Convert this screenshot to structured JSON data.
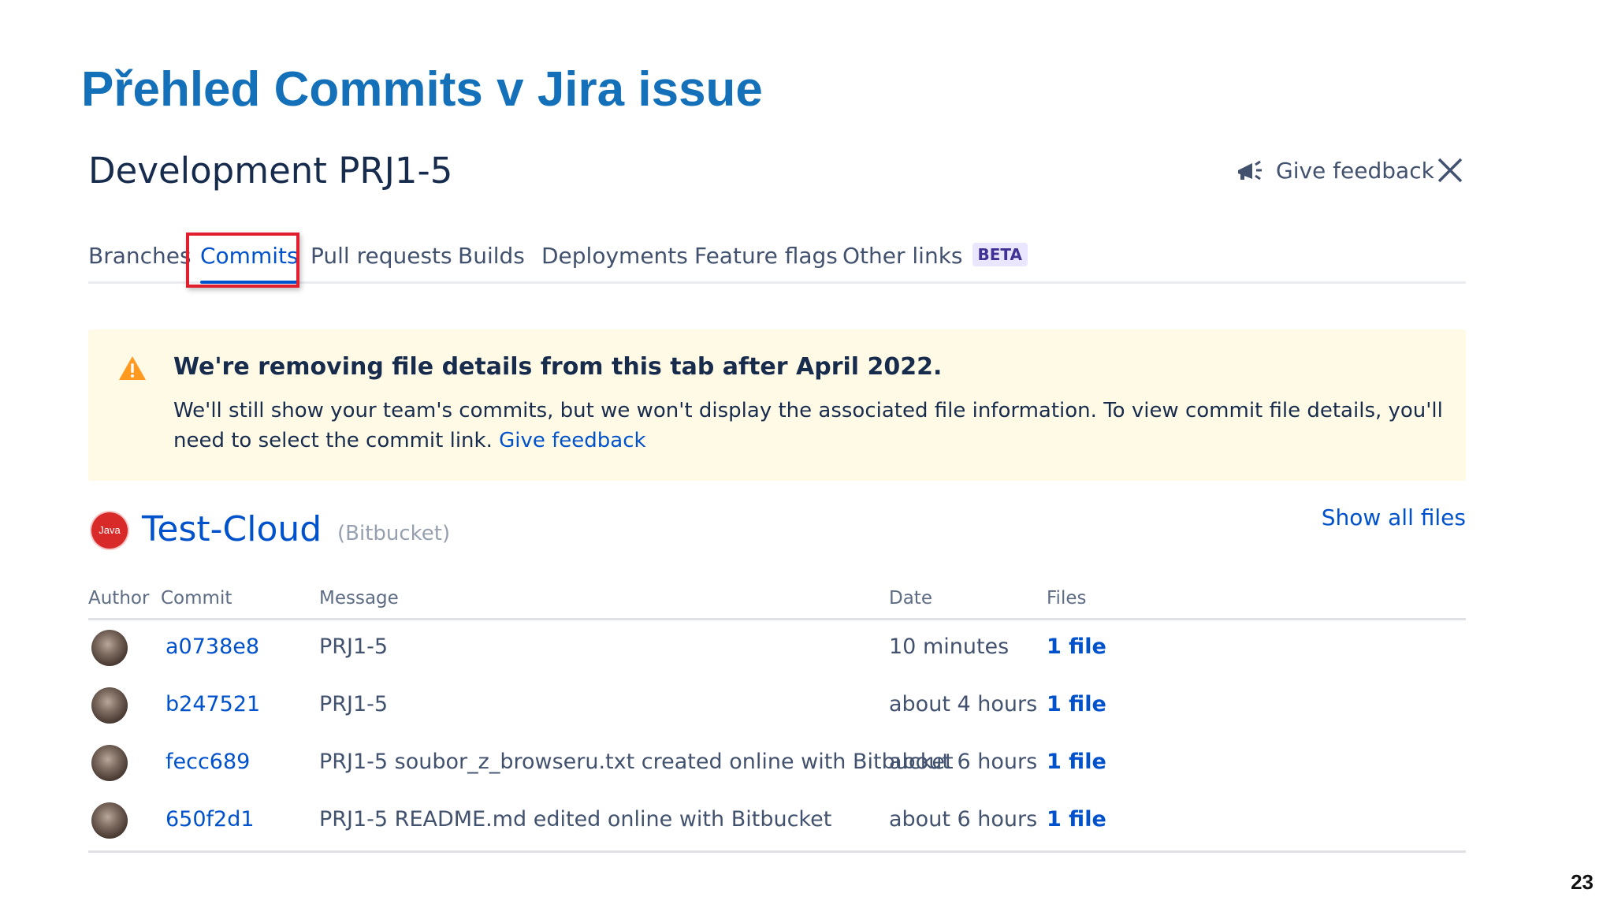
{
  "slide": {
    "title": "Přehled Commits v Jira issue",
    "page_number": "23"
  },
  "panel": {
    "title": "Development PRJ1-5",
    "feedback_label": "Give feedback"
  },
  "tabs": [
    {
      "label": "Branches"
    },
    {
      "label": "Commits",
      "active": true
    },
    {
      "label": "Pull requests"
    },
    {
      "label": "Builds"
    },
    {
      "label": "Deployments"
    },
    {
      "label": "Feature flags"
    },
    {
      "label": "Other links",
      "badge": "BETA"
    }
  ],
  "warning": {
    "title": "We're removing file details from this tab after April 2022.",
    "body": "We'll still show your team's commits, but we won't display the associated file information. To view commit file details, you'll need to select the commit link.",
    "link": "Give feedback"
  },
  "repository": {
    "avatar_text": "Java",
    "name": "Test-Cloud",
    "source": "(Bitbucket)",
    "show_all_label": "Show all files"
  },
  "table": {
    "headers": {
      "author": "Author",
      "commit": "Commit",
      "message": "Message",
      "date": "Date",
      "files": "Files"
    },
    "rows": [
      {
        "commit": "a0738e8",
        "message": "PRJ1-5",
        "date": "10 minutes",
        "files": "1 file"
      },
      {
        "commit": "b247521",
        "message": "PRJ1-5",
        "date": "about 4 hours",
        "files": "1 file"
      },
      {
        "commit": "fecc689",
        "message": "PRJ1-5 soubor_z_browseru.txt created online with Bitbucket",
        "date": "about 6 hours",
        "files": "1 file"
      },
      {
        "commit": "650f2d1",
        "message": "PRJ1-5 README.md edited online with Bitbucket",
        "date": "about 6 hours",
        "files": "1 file"
      }
    ]
  },
  "colors": {
    "slide_title": "#1470b8",
    "link": "#0052cc",
    "warning_bg": "#fffae6",
    "highlight_border": "#e01e2e"
  }
}
